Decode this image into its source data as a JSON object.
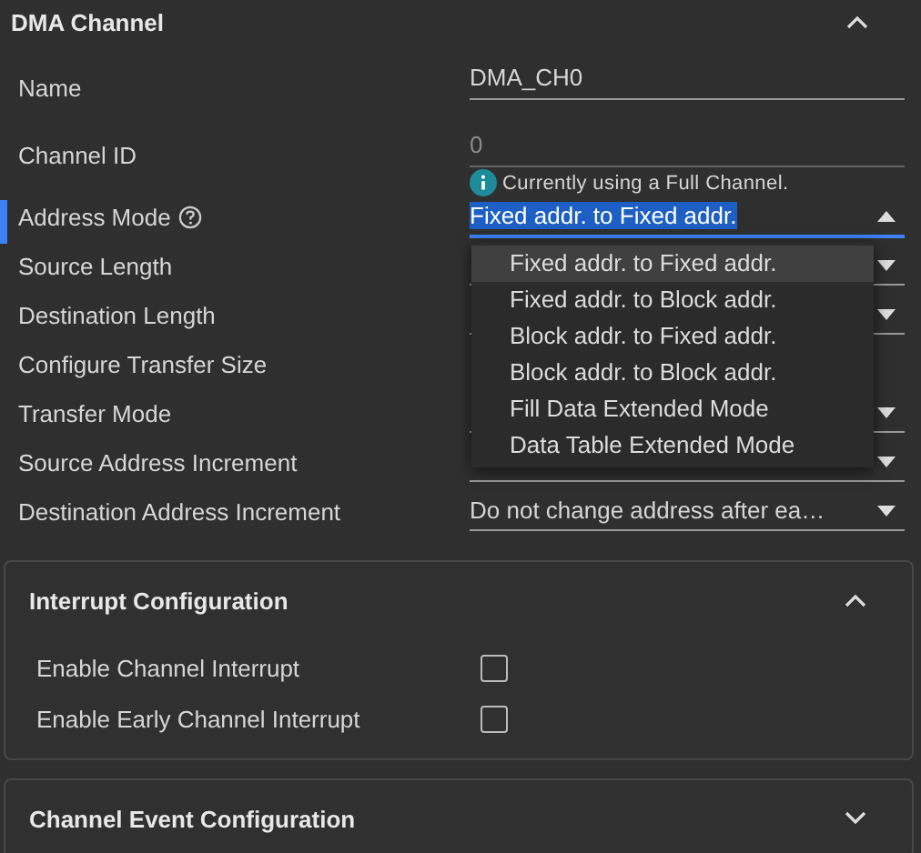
{
  "section": {
    "title": "DMA Channel",
    "expanded": true
  },
  "fields": [
    {
      "label": "Name",
      "kind": "text",
      "value": "DMA_CH0"
    },
    {
      "label": "Channel ID",
      "kind": "text",
      "value": "0",
      "disabled": true,
      "note": "Currently using a Full Channel."
    },
    {
      "label": "Address Mode",
      "kind": "select",
      "help": true,
      "focused": true,
      "value": "Fixed addr. to Fixed addr.",
      "options": [
        {
          "label": "Fixed addr. to Fixed addr.",
          "selected": true
        },
        {
          "label": "Fixed addr. to Block addr.",
          "selected": false
        },
        {
          "label": "Block addr. to Fixed addr.",
          "selected": false
        },
        {
          "label": "Block addr. to Block addr.",
          "selected": false
        },
        {
          "label": "Fill Data Extended Mode",
          "selected": false
        },
        {
          "label": "Data Table Extended Mode",
          "selected": false
        }
      ]
    },
    {
      "label": "Source Length",
      "kind": "select"
    },
    {
      "label": "Destination Length",
      "kind": "select"
    },
    {
      "label": "Configure Transfer Size",
      "kind": "none"
    },
    {
      "label": "Transfer Mode",
      "kind": "select"
    },
    {
      "label": "Source Address Increment",
      "kind": "select"
    },
    {
      "label": "Destination Address Increment",
      "kind": "select",
      "value": "Do not change address after ea…"
    }
  ],
  "panels": [
    {
      "title": "Interrupt Configuration",
      "expanded": true,
      "options": [
        {
          "label": "Enable Channel Interrupt",
          "checked": false
        },
        {
          "label": "Enable Early Channel Interrupt",
          "checked": false
        }
      ]
    },
    {
      "title": "Channel Event Configuration",
      "expanded": false
    }
  ]
}
